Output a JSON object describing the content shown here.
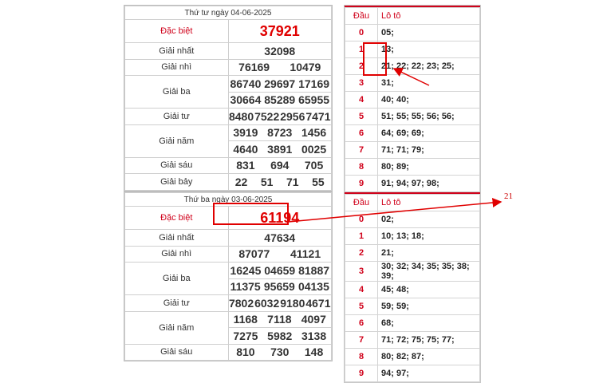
{
  "draw1": {
    "caption": "Thứ tư ngày 04-06-2025",
    "special_label": "Đặc biệt",
    "special": "37921",
    "rows": [
      {
        "label": "Giải nhất",
        "values": [
          [
            "32098"
          ]
        ]
      },
      {
        "label": "Giải nhì",
        "values": [
          [
            "76169",
            "10479"
          ]
        ]
      },
      {
        "label": "Giải ba",
        "values": [
          [
            "86740",
            "29697",
            "17169"
          ],
          [
            "30664",
            "85289",
            "65955"
          ]
        ]
      },
      {
        "label": "Giải tư",
        "values": [
          [
            "8480",
            "7522",
            "2956",
            "7471"
          ]
        ]
      },
      {
        "label": "Giải năm",
        "values": [
          [
            "3919",
            "8723",
            "1456"
          ],
          [
            "4640",
            "3891",
            "0025"
          ]
        ]
      },
      {
        "label": "Giải sáu",
        "values": [
          [
            "831",
            "694",
            "705"
          ]
        ]
      },
      {
        "label": "Giải bảy",
        "values": [
          [
            "22",
            "51",
            "71",
            "55"
          ]
        ]
      }
    ]
  },
  "draw2": {
    "caption": "Thứ ba ngày 03-06-2025",
    "special_label": "Đặc biệt",
    "special": "61194",
    "rows": [
      {
        "label": "Giải nhất",
        "values": [
          [
            "47634"
          ]
        ]
      },
      {
        "label": "Giải nhì",
        "values": [
          [
            "87077",
            "41121"
          ]
        ]
      },
      {
        "label": "Giải ba",
        "values": [
          [
            "16245",
            "04659",
            "81887"
          ],
          [
            "11375",
            "95659",
            "04135"
          ]
        ]
      },
      {
        "label": "Giải tư",
        "values": [
          [
            "7802",
            "6032",
            "9180",
            "4671"
          ]
        ]
      },
      {
        "label": "Giải năm",
        "values": [
          [
            "1168",
            "7118",
            "4097"
          ],
          [
            "7275",
            "5982",
            "3138"
          ]
        ]
      },
      {
        "label": "Giải sáu",
        "values": [
          [
            "810",
            "730",
            "148"
          ]
        ]
      }
    ]
  },
  "loto1": {
    "head_dau": "Đầu",
    "head_loto": "Lô tô",
    "rows": [
      {
        "d": "0",
        "v": "05;"
      },
      {
        "d": "1",
        "v": "13;"
      },
      {
        "d": "2",
        "v": "21; 22; 22; 23; 25;"
      },
      {
        "d": "3",
        "v": "31;"
      },
      {
        "d": "4",
        "v": "40; 40;"
      },
      {
        "d": "5",
        "v": "51; 55; 55; 56; 56;"
      },
      {
        "d": "6",
        "v": "64; 69; 69;"
      },
      {
        "d": "7",
        "v": "71; 71; 79;"
      },
      {
        "d": "8",
        "v": "80; 89;"
      },
      {
        "d": "9",
        "v": "91; 94; 97; 98;"
      }
    ]
  },
  "loto2": {
    "head_dau": "Đầu",
    "head_loto": "Lô tô",
    "rows": [
      {
        "d": "0",
        "v": "02;"
      },
      {
        "d": "1",
        "v": "10; 13; 18;"
      },
      {
        "d": "2",
        "v": "21;"
      },
      {
        "d": "3",
        "v": "30; 32; 34; 35; 35; 38; 39;"
      },
      {
        "d": "4",
        "v": "45; 48;"
      },
      {
        "d": "5",
        "v": "59; 59;"
      },
      {
        "d": "6",
        "v": "68;"
      },
      {
        "d": "7",
        "v": "71; 72; 75; 75; 77;"
      },
      {
        "d": "8",
        "v": "80; 82; 87;"
      },
      {
        "d": "9",
        "v": "94; 97;"
      }
    ]
  },
  "annotation": {
    "text": "21",
    "color": "#e00000"
  }
}
